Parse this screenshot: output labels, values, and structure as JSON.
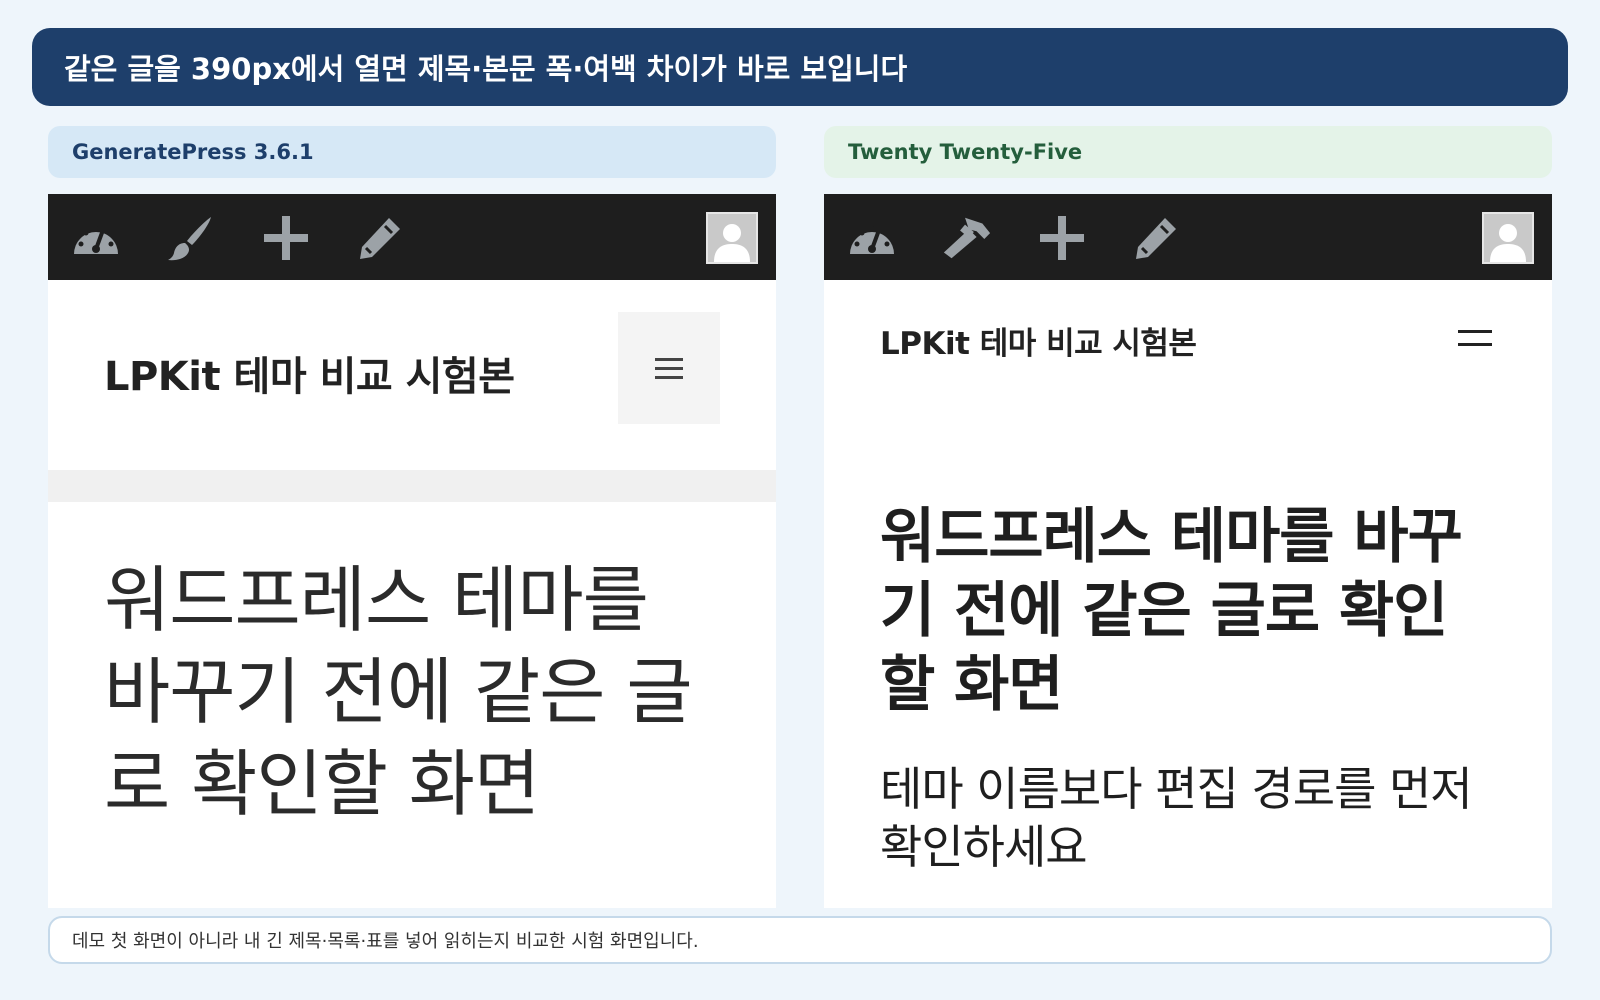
{
  "banner": {
    "title": "같은 글을 390px에서 열면 제목·본문 폭·여백 차이가 바로 보입니다"
  },
  "left_panel": {
    "theme_label": "GeneratePress 3.6.1",
    "adminbar_icons": [
      "dashboard-icon",
      "customize-brush-icon",
      "new-plus-icon",
      "edit-pencil-icon",
      "avatar"
    ],
    "site_title": "LPKit 테마 비교 시험본",
    "menu_icon": "hamburger-icon",
    "entry_title": "워드프레스 테마를 바꾸기 전에 같은 글로 확인할 화면"
  },
  "right_panel": {
    "theme_label": "Twenty Twenty-Five",
    "adminbar_icons": [
      "dashboard-icon",
      "site-editor-icon",
      "new-plus-icon",
      "edit-pencil-icon",
      "avatar"
    ],
    "site_title": "LPKit 테마 비교 시험본",
    "menu_icon": "hamburger-icon",
    "entry_title": "워드프레스 테마를 바꾸기 전에 같은 글로 확인할 화면",
    "lead_text": "테마 이름보다 편집 경로를 먼저 확인하세요"
  },
  "footer_note": "데모 첫 화면이 아니라 내 긴 제목·목록·표를 넣어 읽히는지 비교한 시험 화면입니다.",
  "colors": {
    "page_bg": "#eef5fb",
    "banner_bg": "#1e3f6b",
    "label_left_bg": "#d6e8f6",
    "label_right_bg": "#e4f3e8",
    "adminbar_bg": "#1e1e1e",
    "adminbar_icon": "#9ca2a7"
  }
}
